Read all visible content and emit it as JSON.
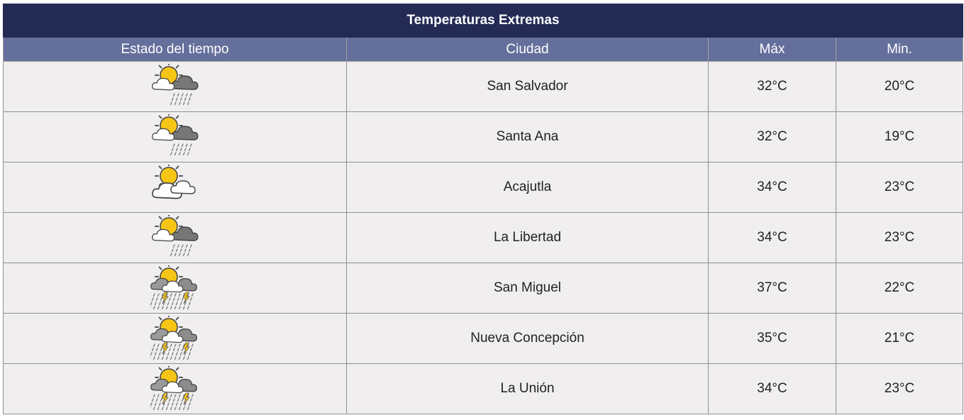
{
  "table": {
    "title": "Temperaturas Extremas",
    "headers": {
      "weather": "Estado del tiempo",
      "city": "Ciudad",
      "max": "Máx",
      "min": "Min."
    },
    "rows": [
      {
        "icon": "partly-cloudy-rain-icon",
        "city": "San Salvador",
        "max": "32°C",
        "min": "20°C"
      },
      {
        "icon": "partly-cloudy-rain-icon",
        "city": "Santa Ana",
        "max": "32°C",
        "min": "19°C"
      },
      {
        "icon": "partly-cloudy-icon",
        "city": "Acajutla",
        "max": "34°C",
        "min": "23°C"
      },
      {
        "icon": "partly-cloudy-rain-icon",
        "city": "La Libertad",
        "max": "34°C",
        "min": "23°C"
      },
      {
        "icon": "thunderstorm-icon",
        "city": "San Miguel",
        "max": "37°C",
        "min": "22°C"
      },
      {
        "icon": "thunderstorm-icon",
        "city": "Nueva Concepción",
        "max": "35°C",
        "min": "21°C"
      },
      {
        "icon": "thunderstorm-icon",
        "city": "La Unión",
        "max": "34°C",
        "min": "23°C"
      }
    ]
  },
  "colors": {
    "title_bg": "#232b55",
    "header_bg": "#646f9b",
    "cell_bg": "#f0eeee",
    "sun": "#f7c515"
  }
}
